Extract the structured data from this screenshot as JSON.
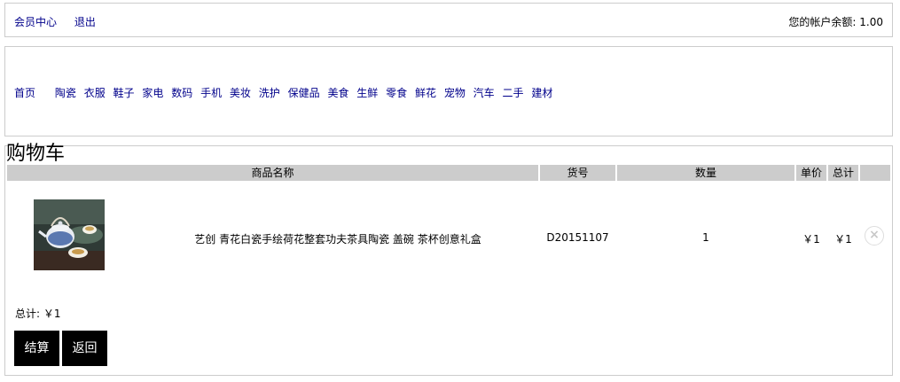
{
  "topbar": {
    "links": [
      "会员中心",
      "退出"
    ],
    "balance_label": "您的帐户余额: 1.00"
  },
  "nav": {
    "home": "首页",
    "categories": [
      "陶瓷",
      "衣服",
      "鞋子",
      "家电",
      "数码",
      "手机",
      "美妆",
      "洗护",
      "保健品",
      "美食",
      "生鲜",
      "零食",
      "鲜花",
      "宠物",
      "汽车",
      "二手",
      "建材"
    ]
  },
  "cart": {
    "title": "购物车",
    "headers": {
      "name": "商品名称",
      "code": "货号",
      "qty": "数量",
      "unit": "单价",
      "subtotal": "总计"
    },
    "items": [
      {
        "image_icon": "teapot-product-image",
        "name": "艺创 青花白瓷手绘荷花整套功夫茶具陶瓷 盖碗 茶杯创意礼盒",
        "code": "D20151107",
        "qty": "1",
        "unit_price": "￥1",
        "subtotal": "￥1",
        "remove_icon": "×"
      }
    ],
    "total": "总计: ￥1",
    "checkout_label": "结算",
    "back_label": "返回"
  }
}
